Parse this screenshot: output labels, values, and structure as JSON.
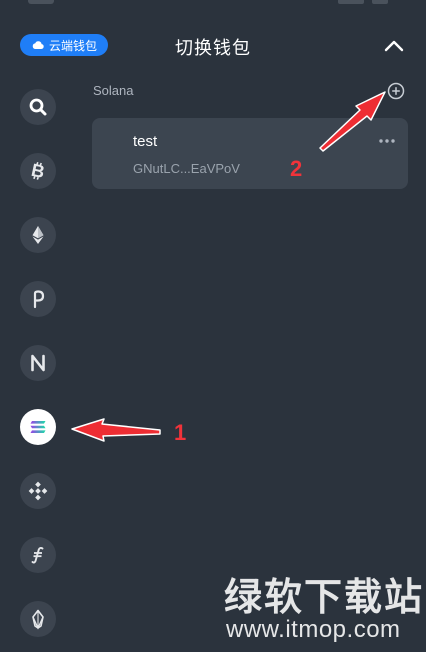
{
  "header": {
    "cloud_badge_label": "云端钱包",
    "title": "切换钱包"
  },
  "sidebar": {
    "chains": [
      {
        "icon": "search-icon",
        "active": false
      },
      {
        "icon": "bitcoin-icon",
        "active": false
      },
      {
        "icon": "ethereum-icon",
        "active": false
      },
      {
        "icon": "polkadot-icon",
        "active": false
      },
      {
        "icon": "near-icon",
        "active": false
      },
      {
        "icon": "solana-icon",
        "active": true
      },
      {
        "icon": "bnb-icon",
        "active": false
      },
      {
        "icon": "filecoin-icon",
        "active": false
      },
      {
        "icon": "eos-icon",
        "active": false
      }
    ]
  },
  "section": {
    "label": "Solana"
  },
  "wallet": {
    "name": "test",
    "address": "GNutLC...EaVPoV"
  },
  "annotations": {
    "num1": "1",
    "num2": "2"
  },
  "watermark": {
    "cn": "绿软下载站",
    "url": "www.itmop.com"
  },
  "colors": {
    "background": "#2b333d",
    "card": "#3c4550",
    "accent_blue": "#1f7ef7",
    "annotation_red": "#f0333a"
  }
}
